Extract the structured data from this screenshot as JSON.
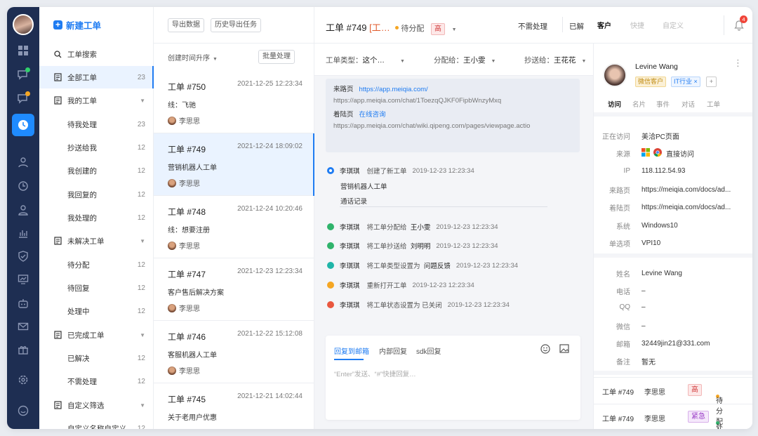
{
  "nav": {
    "new_ticket": "新建工单",
    "items": [
      {
        "label": "工单搜索",
        "count": "",
        "caret": ""
      },
      {
        "label": "全部工单",
        "count": "23",
        "caret": ""
      },
      {
        "label": "我的工单",
        "count": "",
        "caret": "▼"
      },
      {
        "label": "待我处理",
        "count": "23",
        "caret": ""
      },
      {
        "label": "抄送给我",
        "count": "12",
        "caret": ""
      },
      {
        "label": "我创建的",
        "count": "12",
        "caret": ""
      },
      {
        "label": "我回复的",
        "count": "12",
        "caret": ""
      },
      {
        "label": "我处理的",
        "count": "12",
        "caret": ""
      },
      {
        "label": "未解决工单",
        "count": "",
        "caret": "▼"
      },
      {
        "label": "待分配",
        "count": "12",
        "caret": ""
      },
      {
        "label": "待回复",
        "count": "12",
        "caret": ""
      },
      {
        "label": "处理中",
        "count": "12",
        "caret": ""
      },
      {
        "label": "已完成工单",
        "count": "",
        "caret": "▼"
      },
      {
        "label": "已解决",
        "count": "12",
        "caret": ""
      },
      {
        "label": "不需处理",
        "count": "12",
        "caret": ""
      },
      {
        "label": "自定义筛选",
        "count": "",
        "caret": "▼"
      },
      {
        "label": "自定义名称自定义",
        "count": "12",
        "caret": ""
      }
    ]
  },
  "list": {
    "export_btn": "导出数据",
    "history_btn": "历史导出任务",
    "sort": "创建时间升序",
    "batch": "批量处理",
    "cards": [
      {
        "title": "工单 #750",
        "time": "2021-12-25 12:23:34",
        "sub": "线：飞驰",
        "user": "李思思"
      },
      {
        "title": "工单 #749",
        "time": "2021-12-24 18:09:02",
        "sub": "营销机器人工单",
        "user": "李思思"
      },
      {
        "title": "工单 #748",
        "time": "2021-12-24 10:20:46",
        "sub": "线：想要注册",
        "user": "李思思"
      },
      {
        "title": "工单 #747",
        "time": "2021-12-23 12:23:34",
        "sub": "客户售后解决方案",
        "user": "李思思"
      },
      {
        "title": "工单 #746",
        "time": "2021-12-22 15:12:08",
        "sub": "客服机器人工单",
        "user": "李思思"
      },
      {
        "title": "工单 #745",
        "time": "2021-12-21 14:02:44",
        "sub": "关于老用户优惠",
        "user": ""
      }
    ]
  },
  "detail": {
    "title": "工单 #749",
    "type": "[工…",
    "status": "待分配",
    "priority": "高",
    "btn_no_need": "不需处理",
    "btn_done": "已解",
    "tabs": [
      "客户",
      "快捷",
      "自定义"
    ],
    "notif_count": "4",
    "filter_type_label": "工单类型：",
    "filter_type_value": "这个…",
    "filter_assign_label": "分配给：",
    "filter_assign_value": "王小雯",
    "filter_cc_label": "抄送给：",
    "filter_cc_value": "王花花",
    "source": {
      "from_label": "来路页",
      "from_url": "https://app.meiqia.com/",
      "from_full": "https://app.meiqia.com/chat/1ToezqQJKF0FipbWnzyMxq",
      "land_label": "着陆页",
      "land_link": "在线咨询",
      "land_full": "https://app.meiqia.com/chat/wiki.qipeng.com/pages/viewpage.actio"
    },
    "created": {
      "name": "李琪琪",
      "action": "创建了新工单",
      "time": "2019-12-23 12:23:34",
      "sub": "营销机器人工单",
      "link": "通话记录"
    },
    "events": [
      {
        "name": "李琪琪",
        "action": "将工单分配给",
        "target": "王小雯",
        "time": "2019-12-23 12:23:34",
        "color": "#2fb36b"
      },
      {
        "name": "李琪琪",
        "action": "将工单抄送给",
        "target": "刘明明",
        "time": "2019-12-23 12:23:34",
        "color": "#2fb36b"
      },
      {
        "name": "李琪琪",
        "action": "将工单类型设置为",
        "target": "问题反馈",
        "time": "2019-12-23 12:23:34",
        "color": "#1fb5a8"
      },
      {
        "name": "李琪琪",
        "action": "重新打开工单",
        "target": "",
        "time": "2019-12-23 12:23:34",
        "color": "#f5a623"
      },
      {
        "name": "李琪琪",
        "action": "将工单状态设置为 已关闭",
        "target": "",
        "time": "2019-12-23 12:23:34",
        "color": "#e9573f"
      }
    ],
    "reply_tabs": [
      "回复到邮箱",
      "内部回复",
      "sdk回复"
    ],
    "reply_placeholder": "“Enter”发送、“#”快捷回复…"
  },
  "customer": {
    "name": "Levine Wang",
    "tag1": "微信客户",
    "tag2": "IT行业 ×",
    "tabs": [
      "访问",
      "名片",
      "事件",
      "对话",
      "工单"
    ],
    "visit": [
      {
        "k": "正在访问",
        "v": "美洽PC页面"
      },
      {
        "k": "来源",
        "v": "直接访问"
      },
      {
        "k": "IP",
        "v": "118.112.54.93"
      },
      {
        "k": "来路页",
        "v": "https://meiqia.com/docs/ad..."
      },
      {
        "k": "着陆页",
        "v": "https://meiqia.com/docs/ad..."
      },
      {
        "k": "系统",
        "v": "Windows10"
      },
      {
        "k": "单选项",
        "v": "VPI10"
      }
    ],
    "profile": [
      {
        "k": "姓名",
        "v": "Levine Wang"
      },
      {
        "k": "电话",
        "v": "–"
      },
      {
        "k": "QQ",
        "v": "–"
      },
      {
        "k": "微信",
        "v": "–"
      },
      {
        "k": "邮箱",
        "v": "32449jin21@331.com"
      },
      {
        "k": "备注",
        "v": "暂无"
      }
    ],
    "related": [
      {
        "title": "工单 #749",
        "user": "李思思",
        "priority": "高",
        "status": "待分配"
      },
      {
        "title": "工单 #749",
        "user": "李思思",
        "priority": "紧急",
        "status": "处理中"
      }
    ]
  },
  "colors": {
    "accent": "#1f7cf2",
    "rail": "#1e2e52",
    "high": "#d13a3a",
    "urgent": "#9b3fc7"
  }
}
